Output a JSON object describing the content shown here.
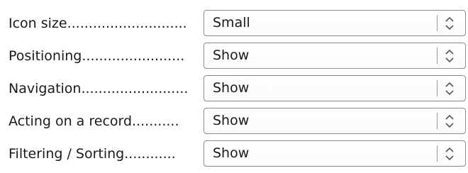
{
  "settings": {
    "rows": [
      {
        "label": "Icon size............................",
        "value": "Small"
      },
      {
        "label": "Positioning........................",
        "value": "Show"
      },
      {
        "label": "Navigation.........................",
        "value": "Show"
      },
      {
        "label": "Acting on a record...........",
        "value": "Show"
      },
      {
        "label": "Filtering / Sorting............",
        "value": "Show"
      }
    ]
  },
  "icons": {
    "spin": "up-down-chevron-icon"
  }
}
